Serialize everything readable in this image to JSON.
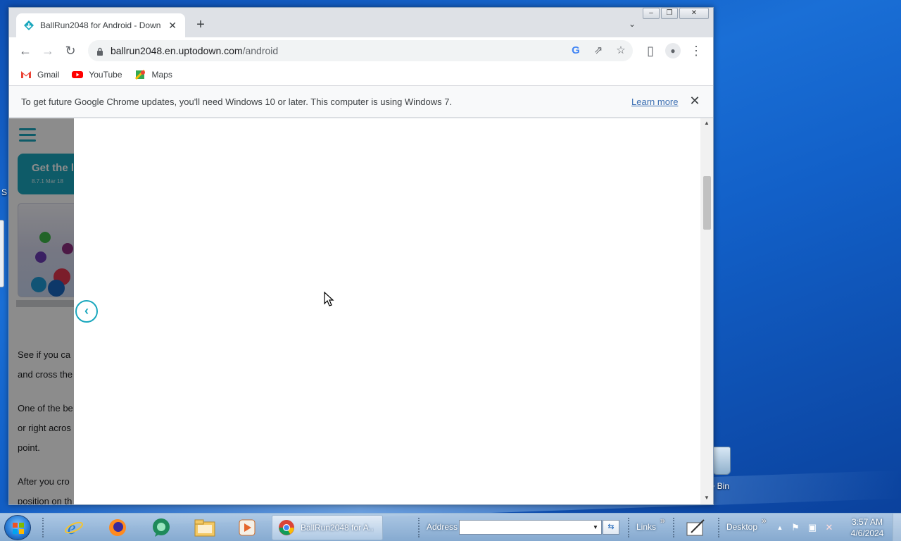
{
  "desktop": {
    "recycle_bin_label": "le Bin",
    "left_edge_label": "S"
  },
  "browser": {
    "tab": {
      "title": "BallRun2048 for Android - Down",
      "close": "✕"
    },
    "new_tab": "+",
    "tab_list": "⌄",
    "window_controls": {
      "minimize": "–",
      "restore": "❐",
      "close": "✕"
    },
    "toolbar": {
      "back": "←",
      "forward": "→",
      "reload": "↻",
      "url_host": "ballrun2048.en.uptodown.com",
      "url_path": "/android",
      "google_icon": "G",
      "share_icon": "⇗",
      "star_icon": "☆",
      "sidepanel_icon": "▯",
      "profile_icon": "●",
      "menu_icon": "⋮"
    },
    "bookmarks": [
      {
        "label": "Gmail",
        "icon": "gmail-icon"
      },
      {
        "label": "YouTube",
        "icon": "youtube-icon"
      },
      {
        "label": "Maps",
        "icon": "maps-icon"
      }
    ],
    "infobar": {
      "message": "To get future Google Chrome updates, you'll need Windows 10 or later. This computer is using Windows 7.",
      "link": "Learn more",
      "close": "✕"
    }
  },
  "page": {
    "card_title": "Get the l",
    "card_meta": "8.7.1    Mar 18",
    "paragraphs": [
      "See if you ca",
      "and cross the",
      "One of the be",
      "or right acros",
      "point.",
      "After you cro",
      "position on th"
    ],
    "back_arrow": "‹",
    "scroll_up": "▲",
    "scroll_down": "▼"
  },
  "taskbar": {
    "app_label": "BallRun2048 for A...",
    "address_label": "Address",
    "address_value": "",
    "go": "⇆",
    "links_label": "Links",
    "desktop_label": "Desktop",
    "chevron": "»",
    "clock_time": "3:57 AM",
    "clock_date": "4/6/2024"
  }
}
